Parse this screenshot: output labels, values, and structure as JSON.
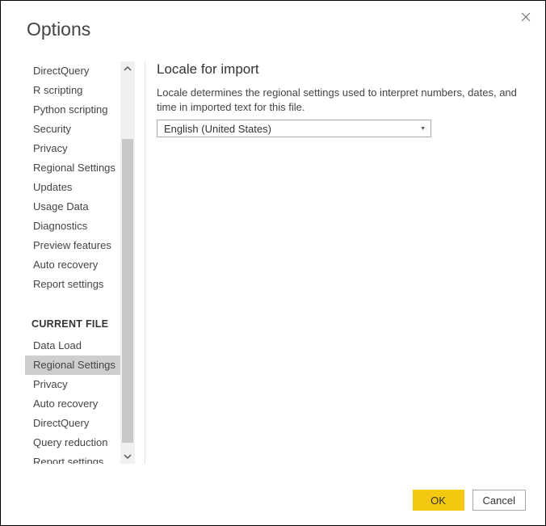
{
  "dialog": {
    "title": "Options"
  },
  "sidebar": {
    "global_items": [
      "DirectQuery",
      "R scripting",
      "Python scripting",
      "Security",
      "Privacy",
      "Regional Settings",
      "Updates",
      "Usage Data",
      "Diagnostics",
      "Preview features",
      "Auto recovery",
      "Report settings"
    ],
    "section_header": "CURRENT FILE",
    "file_items": [
      "Data Load",
      "Regional Settings",
      "Privacy",
      "Auto recovery",
      "DirectQuery",
      "Query reduction",
      "Report settings"
    ],
    "selected": "Regional Settings"
  },
  "main": {
    "title": "Locale for import",
    "description": "Locale determines the regional settings used to interpret numbers, dates, and time in imported text for this file.",
    "dropdown_value": "English (United States)"
  },
  "footer": {
    "ok_label": "OK",
    "cancel_label": "Cancel"
  }
}
